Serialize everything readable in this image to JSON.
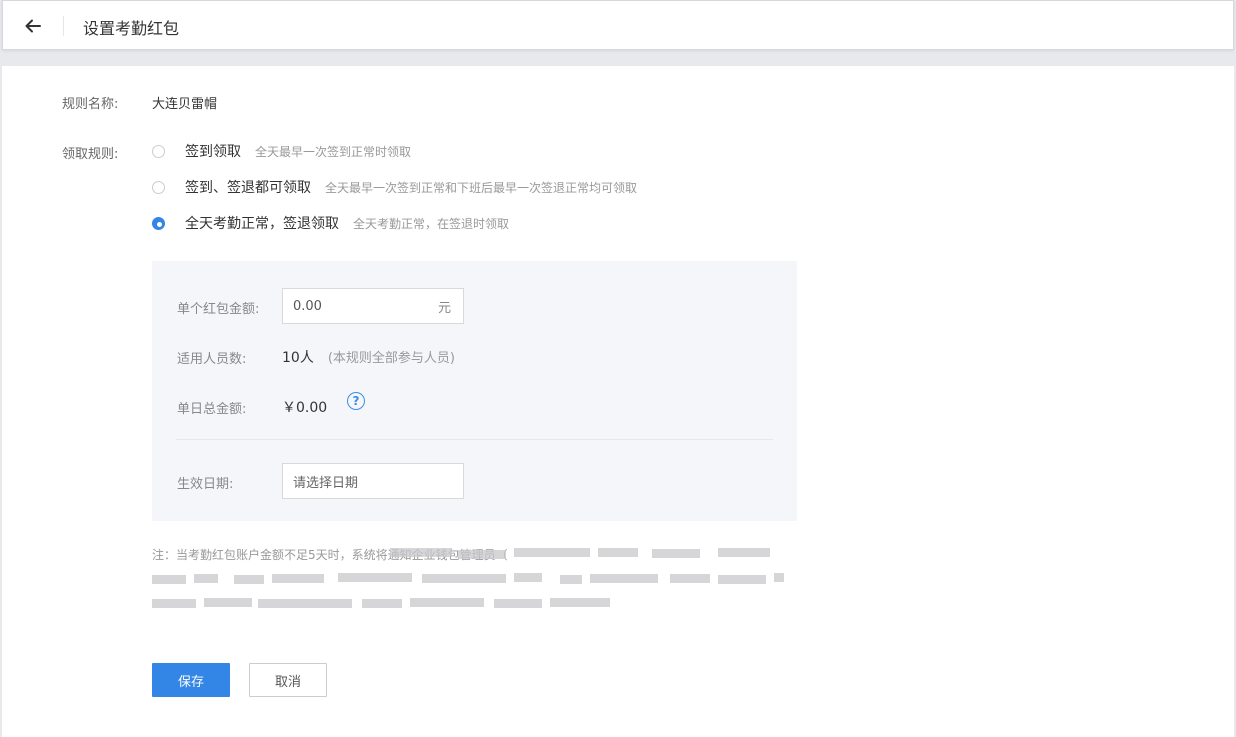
{
  "header": {
    "back_icon": "arrow-left-icon",
    "title": "设置考勤红包"
  },
  "form": {
    "rule_name_label": "规则名称:",
    "rule_name_value": "大连贝雷帽",
    "rule_label": "领取规则:",
    "options": [
      {
        "title": "签到领取",
        "desc": "全天最早一次签到正常时领取",
        "checked": false
      },
      {
        "title": "签到、签退都可领取",
        "desc": "全天最早一次签到正常和下班后最早一次签退正常均可领取",
        "checked": false
      },
      {
        "title": "全天考勤正常，签退领取",
        "desc": "全天考勤正常，在签退时领取",
        "checked": true
      }
    ]
  },
  "panel": {
    "amount_label": "单个红包金额:",
    "amount_value": "0.00",
    "amount_unit": "元",
    "people_label": "适用人员数:",
    "people_value": "10人",
    "people_note": "(本规则全部参与人员)",
    "total_label": "单日总金额:",
    "total_value": "￥0.00",
    "help_icon": "question-circle-icon",
    "help_glyph": "?",
    "date_label": "生效日期:",
    "date_placeholder": "请选择日期"
  },
  "notice": {
    "text": "注：当考勤红包账户金额不足5天时，系统将通知企业钱包管理员（"
  },
  "buttons": {
    "save": "保存",
    "cancel": "取消"
  },
  "colors": {
    "primary": "#3385e6",
    "panel_bg": "#f5f6fa",
    "page_bg": "#e8e9ed"
  }
}
